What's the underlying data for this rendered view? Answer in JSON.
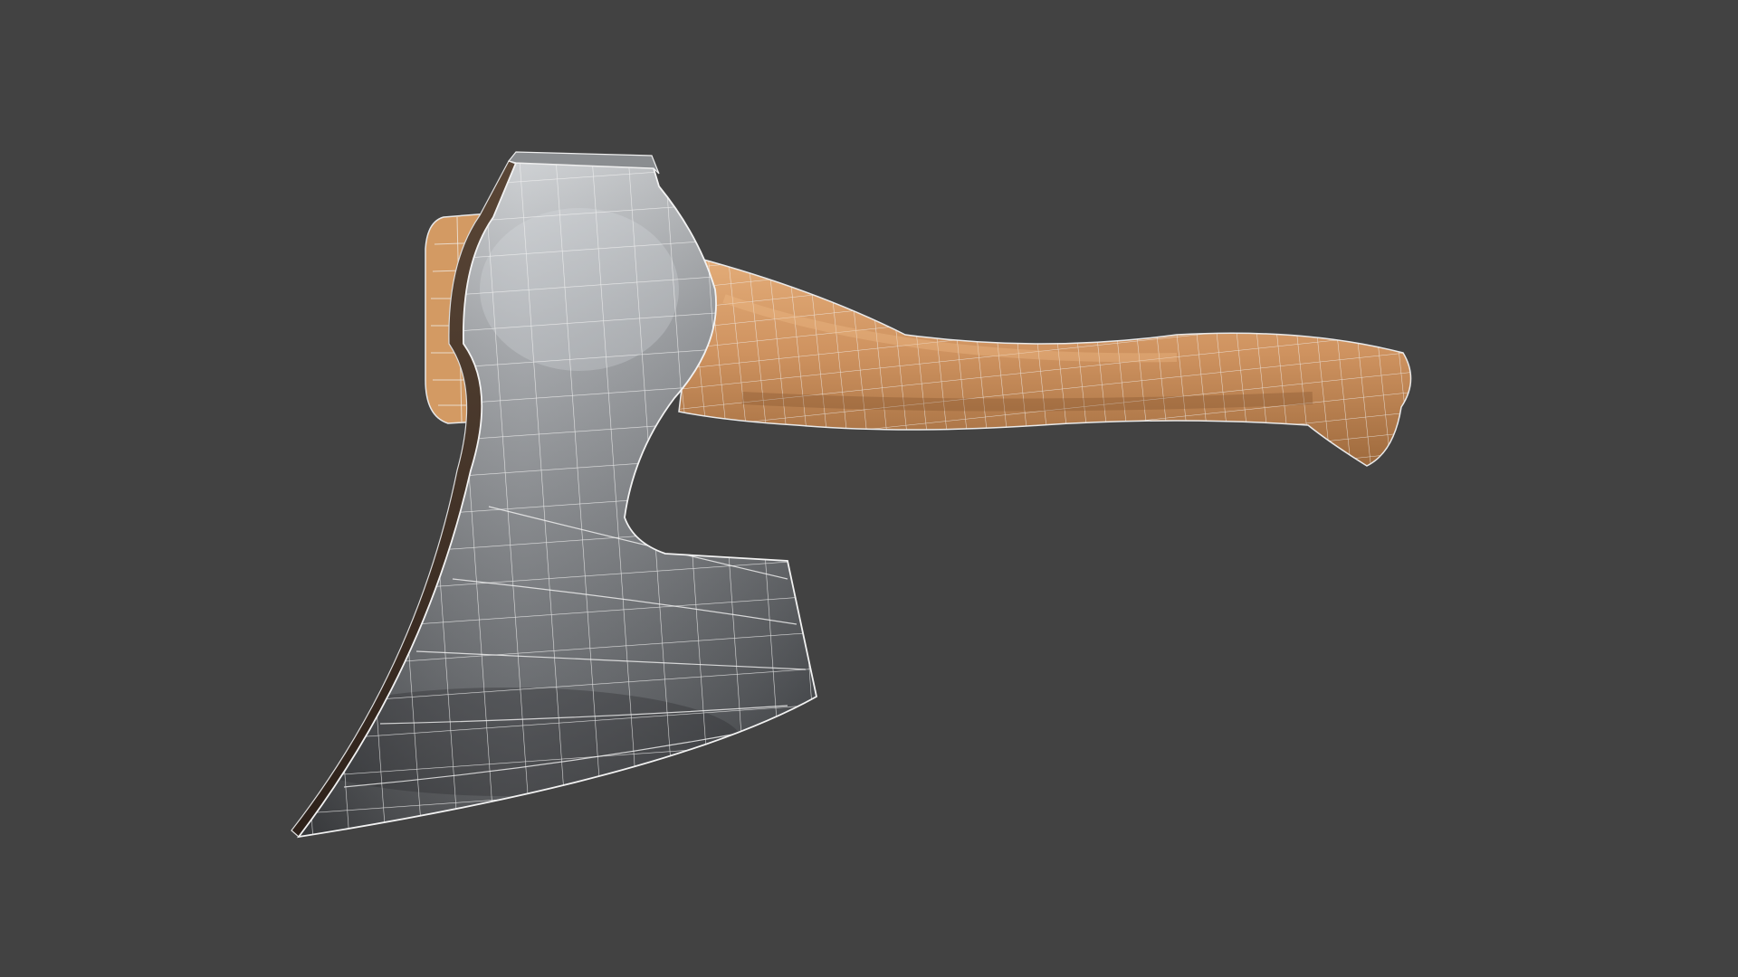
{
  "scene": {
    "background_color": "#424242",
    "subject": "axe-3d-model",
    "display_mode": "textured-with-wireframe-overlay",
    "wireframe_color": "#f2f2f2",
    "materials": {
      "wood_base": "#c98e59",
      "wood_light": "#e0a873",
      "wood_dark": "#9c6638",
      "metal_light": "#b9bcbf",
      "metal_mid": "#7d8084",
      "metal_dark": "#3f4144",
      "edge_brown": "#3a2a20"
    }
  }
}
